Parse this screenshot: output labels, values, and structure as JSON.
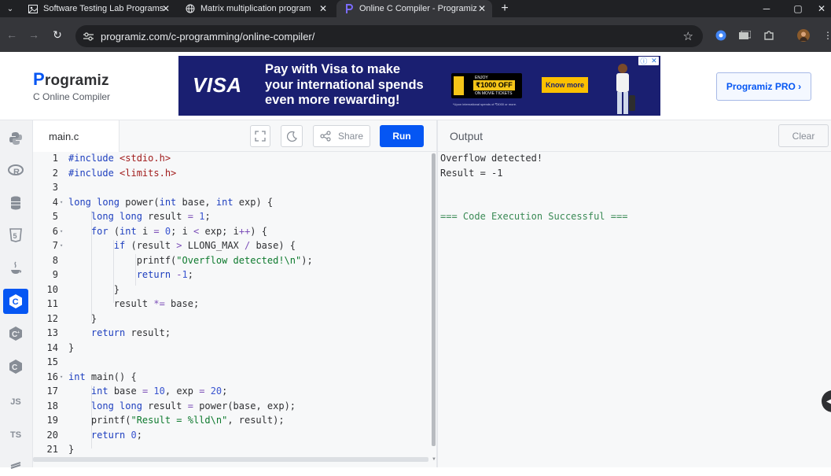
{
  "browser": {
    "tabs": [
      {
        "title": "Software Testing Lab Programs",
        "active": false
      },
      {
        "title": "Matrix multiplication program",
        "active": false
      },
      {
        "title": "Online C Compiler - Programiz",
        "active": true
      }
    ],
    "new_tab": "+",
    "url": "programiz.com/c-programming/online-compiler/",
    "window_controls": [
      "─",
      "▢",
      "✕"
    ]
  },
  "header": {
    "brand": "rogramiz",
    "brand_initial": "P",
    "subtitle": "C Online Compiler",
    "pro_button": "Programiz PRO ›"
  },
  "ad": {
    "visa": "VISA",
    "headline": [
      "Pay with Visa to make",
      "your international spends",
      "even more rewarding!"
    ],
    "pvr_line1": "ENJOY",
    "pvr_offer": "₹1000 OFF",
    "pvr_line3": "ON MOVIE TICKETS",
    "fine_print": "*Upon international spends of ₹3000 or more.",
    "cta": "Know more"
  },
  "languages": [
    {
      "name": "python-icon",
      "glyph": "🐍",
      "active": false
    },
    {
      "name": "r-icon",
      "glyph": "R",
      "active": false
    },
    {
      "name": "sql-icon",
      "glyph": "≡",
      "active": false
    },
    {
      "name": "html5-icon",
      "glyph": "5",
      "active": false
    },
    {
      "name": "java-icon",
      "glyph": "♨",
      "active": false
    },
    {
      "name": "c-icon",
      "glyph": "C",
      "active": true
    },
    {
      "name": "cpp-icon",
      "glyph": "C",
      "active": false
    },
    {
      "name": "csharp-icon",
      "glyph": "C",
      "active": false
    },
    {
      "name": "js-icon",
      "glyph": "JS",
      "active": false
    },
    {
      "name": "ts-icon",
      "glyph": "TS",
      "active": false
    },
    {
      "name": "go-icon",
      "glyph": "≡",
      "active": false
    }
  ],
  "editor": {
    "filename": "main.c",
    "share_label": "Share",
    "run_label": "Run",
    "lines": [
      "#include <stdio.h>",
      "#include <limits.h>",
      "",
      "long long power(int base, int exp) {",
      "    long long result = 1;",
      "    for (int i = 0; i < exp; i++) {",
      "        if (result > LLONG_MAX / base) {",
      "            printf(\"Overflow detected!\\n\");",
      "            return -1;",
      "        }",
      "        result *= base;",
      "    }",
      "    return result;",
      "}",
      "",
      "int main() {",
      "    int base = 10, exp = 20;",
      "    long long result = power(base, exp);",
      "    printf(\"Result = %lld\\n\", result);",
      "    return 0;",
      "}"
    ],
    "line_numbers": [
      "1",
      "2",
      "3",
      "4",
      "5",
      "6",
      "7",
      "8",
      "9",
      "10",
      "11",
      "12",
      "13",
      "14",
      "15",
      "16",
      "17",
      "18",
      "19",
      "20",
      "21"
    ],
    "fold_lines": [
      4,
      6,
      7,
      16
    ]
  },
  "output": {
    "title": "Output",
    "clear_label": "Clear",
    "lines": [
      "Overflow detected!",
      "Result = -1"
    ],
    "success": "=== Code Execution Successful ==="
  }
}
